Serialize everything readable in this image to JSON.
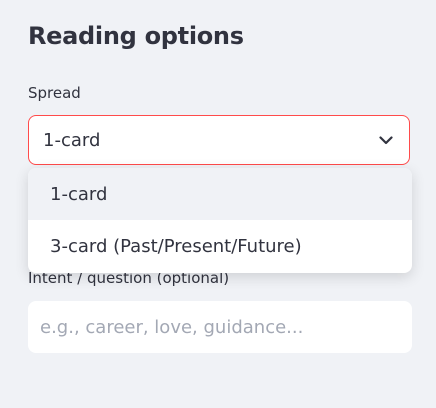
{
  "panel": {
    "heading": "Reading options"
  },
  "spread": {
    "label": "Spread",
    "selected": "1-card",
    "options": [
      "1-card",
      "3-card (Past/Present/Future)"
    ],
    "accent_color": "#ff4b4b"
  },
  "intent": {
    "label": "Intent / question (optional)",
    "value": "",
    "placeholder": "e.g., career, love, guidance..."
  },
  "icons": {
    "select_chevron": "chevron-down-icon"
  }
}
